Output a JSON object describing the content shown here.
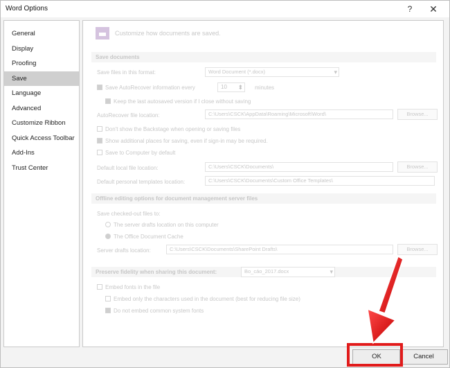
{
  "window": {
    "title": "Word Options",
    "help_label": "?",
    "close_label": "✕"
  },
  "sidebar": {
    "items": [
      {
        "label": "General",
        "selected": false
      },
      {
        "label": "Display",
        "selected": false
      },
      {
        "label": "Proofing",
        "selected": false
      },
      {
        "label": "Save",
        "selected": true
      },
      {
        "label": "Language",
        "selected": false
      },
      {
        "label": "Advanced",
        "selected": false
      },
      {
        "label": "Customize Ribbon",
        "selected": false
      },
      {
        "label": "Quick Access Toolbar",
        "selected": false
      },
      {
        "label": "Add-Ins",
        "selected": false
      },
      {
        "label": "Trust Center",
        "selected": false
      }
    ]
  },
  "content": {
    "header": "Customize how documents are saved.",
    "save_section": {
      "title": "Save documents",
      "format_label": "Save files in this format:",
      "format_value": "Word Document (*.docx)",
      "autorecover_label": "Save AutoRecover information every",
      "autorecover_minutes": "10",
      "minutes_label": "minutes",
      "keep_last_label": "Keep the last autosaved version if I close without saving",
      "autorecover_location_label": "AutoRecover file location:",
      "autorecover_location_value": "C:\\Users\\CSCK\\AppData\\Roaming\\Microsoft\\Word\\",
      "browse_label": "Browse...",
      "dont_show_backstage_label": "Don't show the Backstage when opening or saving files",
      "show_additional_label": "Show additional places for saving, even if sign-in may be required.",
      "save_computer_label": "Save to Computer by default",
      "default_local_label": "Default local file location:",
      "default_local_value": "C:\\Users\\CSCK\\Documents\\",
      "default_templates_label": "Default personal templates location:",
      "default_templates_value": "C:\\Users\\CSCK\\Documents\\Custom Office Templates\\"
    },
    "offline_section": {
      "title": "Offline editing options for document management server files",
      "save_checked_out_label": "Save checked-out files to:",
      "server_drafts_label": "The server drafts location on this computer",
      "office_cache_label": "The Office Document Cache",
      "server_drafts_location_label": "Server drafts location:",
      "server_drafts_location_value": "C:\\Users\\CSCK\\Documents\\SharePoint Drafts\\"
    },
    "fidelity_section": {
      "title": "Preserve fidelity when sharing this document:",
      "doc_value": "Bo_cáo_2017.docx",
      "embed_fonts_label": "Embed fonts in the file",
      "embed_chars_label": "Embed only the characters used in the document (best for reducing file size)",
      "no_common_fonts_label": "Do not embed common system fonts"
    }
  },
  "footer": {
    "ok_label": "OK",
    "cancel_label": "Cancel"
  },
  "annotation": {
    "highlight_color": "#e11b1b"
  }
}
